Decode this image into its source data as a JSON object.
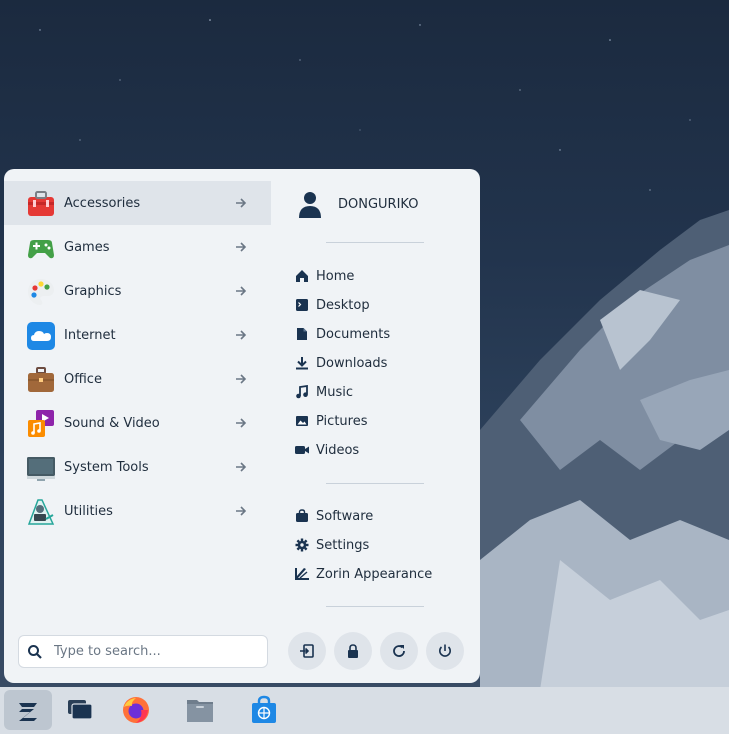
{
  "menu": {
    "categories": [
      {
        "label": "Accessories",
        "icon": "toolbox-icon"
      },
      {
        "label": "Games",
        "icon": "gamepad-icon"
      },
      {
        "label": "Graphics",
        "icon": "palette-icon"
      },
      {
        "label": "Internet",
        "icon": "cloud-icon"
      },
      {
        "label": "Office",
        "icon": "briefcase-icon"
      },
      {
        "label": "Sound & Video",
        "icon": "music-video-icon"
      },
      {
        "label": "System Tools",
        "icon": "monitor-icon"
      },
      {
        "label": "Utilities",
        "icon": "utilities-icon"
      }
    ],
    "active_category": "Accessories",
    "user": {
      "name": "DONGURIKO"
    },
    "places": [
      {
        "label": "Home",
        "icon": "home-icon"
      },
      {
        "label": "Desktop",
        "icon": "desktop-icon"
      },
      {
        "label": "Documents",
        "icon": "document-icon"
      },
      {
        "label": "Downloads",
        "icon": "download-icon"
      },
      {
        "label": "Music",
        "icon": "music-note-icon"
      },
      {
        "label": "Pictures",
        "icon": "image-icon"
      },
      {
        "label": "Videos",
        "icon": "video-camera-icon"
      }
    ],
    "system": [
      {
        "label": "Software",
        "icon": "shopping-bag-icon"
      },
      {
        "label": "Settings",
        "icon": "gear-icon"
      },
      {
        "label": "Zorin Appearance",
        "icon": "appearance-icon"
      }
    ],
    "search": {
      "placeholder": "Type to search...",
      "value": ""
    },
    "power_buttons": [
      "logout-icon",
      "lock-icon",
      "restart-icon",
      "power-icon"
    ]
  },
  "taskbar": {
    "items": [
      "zorin-menu-icon",
      "workspaces-icon",
      "firefox-icon",
      "files-icon",
      "software-store-icon"
    ]
  },
  "colors": {
    "accent": "#1a3350",
    "panel": "#f0f3f6",
    "active_row": "#dfe4ea",
    "taskbar": "#d8dee5"
  }
}
